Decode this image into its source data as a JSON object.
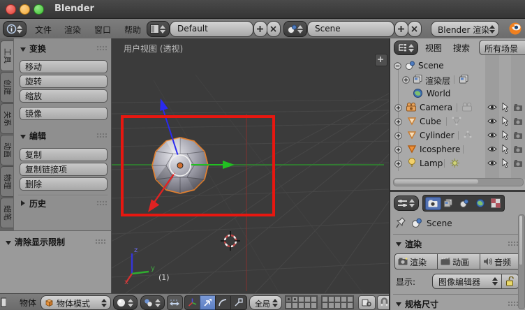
{
  "window": {
    "title": "Blender"
  },
  "topbar": {
    "menus": [
      {
        "label": "文件"
      },
      {
        "label": "渲染"
      },
      {
        "label": "窗口"
      },
      {
        "label": "帮助"
      }
    ],
    "layout": {
      "value": "Default"
    },
    "scene": {
      "value": "Scene"
    },
    "engine": {
      "value": "Blender 渲染"
    }
  },
  "toolshelf": {
    "tabs": [
      {
        "label": "工具"
      },
      {
        "label": "创建"
      },
      {
        "label": "关系"
      },
      {
        "label": "动画"
      },
      {
        "label": "物理"
      },
      {
        "label": "蜡笔"
      }
    ],
    "transform": {
      "title": "变换",
      "move": "移动",
      "rotate": "旋转",
      "scale": "缩放",
      "mirror": "镜像"
    },
    "edit": {
      "title": "编辑",
      "duplicate": "复制",
      "duplicate_linked": "复制链接项",
      "delete": "删除"
    },
    "history": {
      "title": "历史"
    },
    "operator": {
      "title": "清除显示限制"
    }
  },
  "viewport": {
    "view_label": "用户视图 (透视)",
    "layer_indicator": "(1)",
    "axis": {
      "x": "x",
      "y": "y",
      "z": "z"
    }
  },
  "outliner": {
    "menus": [
      {
        "label": "视图"
      },
      {
        "label": "搜索"
      }
    ],
    "display_filter": "所有场景",
    "items": [
      {
        "label": "Scene"
      },
      {
        "label": "渲染层"
      },
      {
        "label": "World"
      },
      {
        "label": "Camera"
      },
      {
        "label": "Cube"
      },
      {
        "label": "Cylinder"
      },
      {
        "label": "Icosphere"
      },
      {
        "label": "Lamp"
      }
    ]
  },
  "properties": {
    "context_path": "Scene",
    "render": {
      "title": "渲染",
      "render_btn": "渲染",
      "animation_btn": "动画",
      "audio_btn": "音频",
      "display_label": "显示:",
      "display_value": "图像编辑器"
    },
    "dimensions": {
      "title": "规格尺寸"
    }
  },
  "bottombar": {
    "object_menu": "物体",
    "mode": "物体模式",
    "orientation": "全局"
  },
  "colors": {
    "accent_blue": "#6a8ecf",
    "selection_orange": "#e2802f",
    "camera_border_red": "#e71710",
    "axis_green": "#2e8b2e",
    "axis_blue": "#2a2af0",
    "axis_red": "#e02222"
  }
}
